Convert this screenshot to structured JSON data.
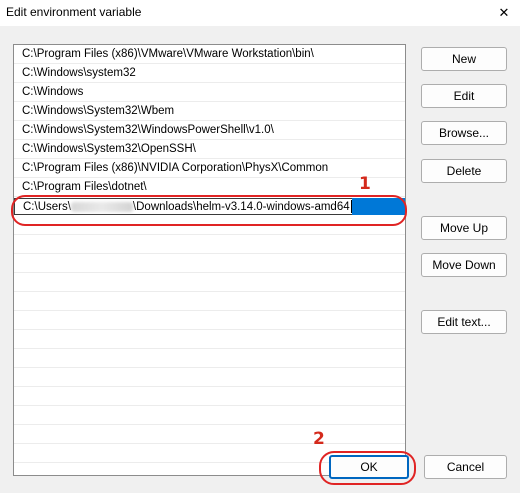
{
  "window": {
    "title": "Edit environment variable",
    "close_glyph": "✕"
  },
  "paths": [
    "C:\\Program Files (x86)\\VMware\\VMware Workstation\\bin\\",
    "C:\\Windows\\system32",
    "C:\\Windows",
    "C:\\Windows\\System32\\Wbem",
    "C:\\Windows\\System32\\WindowsPowerShell\\v1.0\\",
    "C:\\Windows\\System32\\OpenSSH\\",
    "C:\\Program Files (x86)\\NVIDIA Corporation\\PhysX\\Common",
    "C:\\Program Files\\dotnet\\"
  ],
  "editing": {
    "prefix": "C:\\Users\\",
    "suffix": "\\Downloads\\helm-v3.14.0-windows-amd64"
  },
  "buttons": {
    "new": "New",
    "edit": "Edit",
    "browse": "Browse...",
    "delete": "Delete",
    "move_up": "Move Up",
    "move_down": "Move Down",
    "edit_text": "Edit text...",
    "ok": "OK",
    "cancel": "Cancel"
  },
  "annotations": {
    "step1": "1",
    "step2": "2",
    "color": "#e02424"
  },
  "colors": {
    "selection": "#0078d7",
    "primary_border": "#0067c0"
  }
}
